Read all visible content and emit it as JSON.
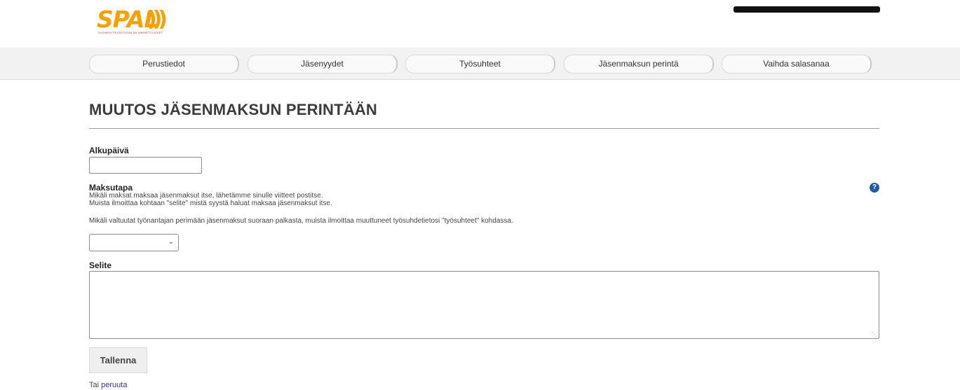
{
  "logo": {
    "wordmark": "SPAL",
    "waves": ")))",
    "tagline": "SUOMEN PELASTUSALAN AMMATTILAISET"
  },
  "nav": {
    "items": [
      {
        "label": "Perustiedot"
      },
      {
        "label": "Jäsenyydet"
      },
      {
        "label": "Työsuhteet"
      },
      {
        "label": "Jäsenmaksun perintä"
      },
      {
        "label": "Vaihda salasanaa"
      }
    ]
  },
  "page": {
    "title": "MUUTOS JÄSENMAKSUN PERINTÄÄN"
  },
  "form": {
    "start_date": {
      "label": "Alkupäivä",
      "value": ""
    },
    "payment_method": {
      "label": "Maksutapa",
      "info_line1": "Mikäli maksat maksaa jäsenmaksut itse, lähetämme sinulle viitteet postitse.",
      "info_line2": "Muista ilmoittaa kohtaan \"selite\" mistä syystä haluat maksaa jäsenmaksut itse.",
      "info_line3": "Mikäli valtuutat työnantajan perimään jäsenmaksut suoraan palkasta, muista ilmoittaa muuttuneet työsuhdetietosi \"työsuhteet\" kohdassa.",
      "selected": ""
    },
    "explanation": {
      "label": "Selite",
      "value": ""
    },
    "save_label": "Tallenna",
    "cancel_prefix": "Tai",
    "cancel_link": "peruuta",
    "help_glyph": "?"
  },
  "colors": {
    "brand": "#f5a100",
    "help_icon": "#1e5aa8",
    "link": "#3a2e8c"
  },
  "icons": [
    "help-icon",
    "chevron-down-icon",
    "resize-handle-icon"
  ]
}
